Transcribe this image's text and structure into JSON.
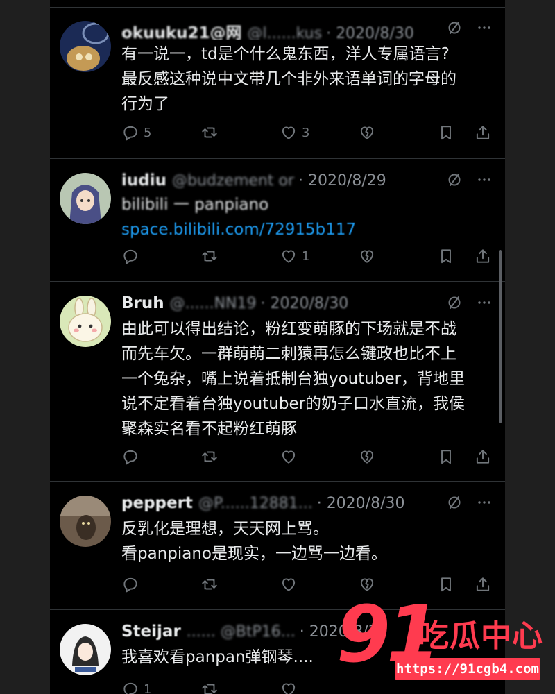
{
  "tweets": [
    {
      "name": "okuuku21@网",
      "handle": "@l......kus",
      "date": "· 2020/8/30",
      "lines": [
        "有一说一，td是个什么鬼东西，洋人专属语言?",
        "最反感这种说中文带几个非外来语单词的字母的",
        "行为了"
      ],
      "reply_count": "5",
      "retweet_count": "",
      "like_count": "3"
    },
    {
      "name": "iudiu",
      "handle": "@budzement or",
      "date": "· 2020/8/29",
      "lines": [
        "bilibili 一 panpiano"
      ],
      "link": "space.bilibili.com/72915b117",
      "reply_count": "",
      "retweet_count": "",
      "like_count": "1"
    },
    {
      "name": "Bruh",
      "handle": "@......NN19",
      "date": "· 2020/8/30",
      "lines": [
        "由此可以得出结论，粉红变萌豚的下场就是不战",
        "而先车欠。一群萌萌二刺猿再怎么键政也比不上",
        "一个兔杂，嘴上说着抵制台独youtuber，背地里",
        "说不定看着台独youtuber的奶子口水直流，我侯",
        "聚森实名看不起粉红萌豚"
      ],
      "reply_count": "",
      "retweet_count": "",
      "like_count": ""
    },
    {
      "name": "peppert",
      "handle": "@P......12881...",
      "date": "· 2020/8/30",
      "lines": [
        "反乳化是理想，天天网上骂。",
        "看panpiano是现实，一边骂一边看。"
      ],
      "reply_count": "",
      "retweet_count": "",
      "like_count": ""
    },
    {
      "name": "Steijar",
      "handle": "...... @BtP16...",
      "date": "· 2020/8/30",
      "lines": [
        "我喜欢看panpan弹钢琴...."
      ],
      "reply_count": "1",
      "retweet_count": "",
      "like_count": ""
    }
  ],
  "watermark": {
    "number": "91",
    "text": "吃瓜中心",
    "url": "https://91cgb4.com"
  },
  "colors": {
    "background": "#000000",
    "text": "#e7e9ea",
    "muted": "#71767b",
    "link": "#1d9bf0",
    "divider": "#2f3336",
    "watermark": "#ff3b4f"
  },
  "icons": [
    "reply-icon",
    "retweet-icon",
    "like-icon",
    "broken-heart-icon",
    "bookmark-icon",
    "share-icon",
    "mute-icon",
    "more-icon"
  ]
}
